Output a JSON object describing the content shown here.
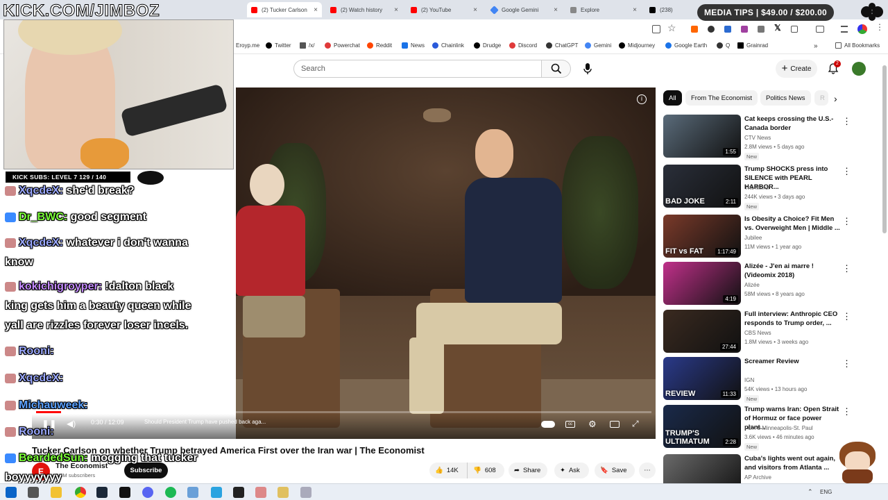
{
  "browser": {
    "tabs": [
      {
        "label": "(2) Tucker Carlson",
        "color": "#ff0000",
        "active": true
      },
      {
        "label": "(2) Watch history",
        "color": "#ff0000",
        "active": false
      },
      {
        "label": "(2) YouTube",
        "color": "#ff0000",
        "active": false
      },
      {
        "label": "Google Gemini",
        "color": "#4285f4",
        "active": false
      },
      {
        "label": "Explore",
        "color": "#888888",
        "active": false
      },
      {
        "label": "(238)",
        "color": "#000000",
        "active": false
      }
    ],
    "bookmarks": [
      {
        "label": "Eroyp.me",
        "color": "#999999"
      },
      {
        "label": "Twitter",
        "color": "#000000"
      },
      {
        "label": "/x/",
        "color": "#555555"
      },
      {
        "label": "Powerchat",
        "color": "#e03a3a"
      },
      {
        "label": "Reddit",
        "color": "#ff4500"
      },
      {
        "label": "News",
        "color": "#1a73e8"
      },
      {
        "label": "Chainlink",
        "color": "#2a5ada"
      },
      {
        "label": "Drudge",
        "color": "#000000"
      },
      {
        "label": "Discord",
        "color": "#5865f2"
      },
      {
        "label": "ChatGPT",
        "color": "#333333"
      },
      {
        "label": "Gemini",
        "color": "#4285f4"
      },
      {
        "label": "Midjourney",
        "color": "#000000"
      },
      {
        "label": "Google Earth",
        "color": "#1a73e8"
      },
      {
        "label": "Q",
        "color": "#333333"
      },
      {
        "label": "Grainrad",
        "color": "#000000"
      }
    ],
    "all_bookmarks": "All Bookmarks"
  },
  "header": {
    "search_placeholder": "Search",
    "create_label": "Create",
    "notif_count": "2"
  },
  "player": {
    "time": "0:30 / 12:09",
    "chapter": "Should President Trump have pushed back aga...",
    "progress": 0.041
  },
  "video": {
    "title": "Tucker Carlson on whether Trump betrayed America First over the Iran war | The Economist",
    "channel": "The Economist",
    "subscribers": "2.4M subscribers",
    "subscribe_label": "Subscribe",
    "likes": "14K",
    "dislikes": "608",
    "share_label": "Share",
    "ask_label": "Ask",
    "save_label": "Save"
  },
  "chips": [
    "All",
    "From The Economist",
    "Politics News",
    "R"
  ],
  "recommendations": [
    {
      "title": "Cat keeps crossing the U.S.-Canada border",
      "channel": "CTV News",
      "meta": "2.8M views • 5 days ago",
      "badge": "New",
      "duration": "1:55",
      "thumb_label": "",
      "thumb_color": "#5a6b7a"
    },
    {
      "title": "Trump SHOCKS press into SILENCE with PEARL HARBOR...",
      "channel": "The Mirror",
      "meta": "244K views • 3 days ago",
      "badge": "New",
      "duration": "2:11",
      "thumb_label": "BAD JOKE",
      "thumb_color": "#2a2f3a"
    },
    {
      "title": "Is Obesity a Choice? Fit Men vs. Overweight Men | Middle ...",
      "channel": "Jubilee",
      "meta": "11M views • 1 year ago",
      "badge": "",
      "duration": "1:17:49",
      "thumb_label": "FIT vs FAT",
      "thumb_color": "#7a3a2a"
    },
    {
      "title": "Alizée - J'en ai marre ! (Videomix 2018)",
      "channel": "Alizée",
      "meta": "58M views • 8 years ago",
      "badge": "",
      "duration": "4:19",
      "thumb_label": "",
      "thumb_color": "#c0308a"
    },
    {
      "title": "Full interview: Anthropic CEO responds to Trump order, ...",
      "channel": "CBS News",
      "meta": "1.8M views • 3 weeks ago",
      "badge": "",
      "duration": "27:44",
      "thumb_label": "",
      "thumb_color": "#3a2a20"
    },
    {
      "title": "Screamer Review",
      "channel": "IGN",
      "meta": "54K views • 13 hours ago",
      "badge": "New",
      "duration": "11:33",
      "thumb_label": "REVIEW",
      "thumb_color": "#2a3a8a"
    },
    {
      "title": "Trump warns Iran: Open Strait of Hormuz or face power plant...",
      "channel": "FOX 9 Minneapolis-St. Paul",
      "meta": "3.6K views • 46 minutes ago",
      "badge": "New",
      "duration": "2:28",
      "thumb_label": "TRUMP'S ULTIMATUM",
      "thumb_color": "#1a2a4a"
    },
    {
      "title": "Cuba's lights went out again, and visitors from Atlanta ...",
      "channel": "AP Archive",
      "meta": "",
      "badge": "",
      "duration": "",
      "thumb_label": "",
      "thumb_color": "#6a6a6a"
    }
  ],
  "overlay": {
    "kick": "KICK.COM/JIMBOZ",
    "media_tips": "MEDIA TIPS | $49.00 / $200.00",
    "subs_bar": "KICK SUBS: LEVEL 7 129 / 140",
    "chat": [
      {
        "user": "XqcdeX:",
        "msg": " she'd break?",
        "color": "#9aa8ff"
      },
      {
        "user": "Dr_BWC:",
        "msg": " good segment",
        "color": "#7cff3a"
      },
      {
        "user": "XqcdeX:",
        "msg": " whatever i don't wanna",
        "color": "#9aa8ff"
      },
      {
        "user": "",
        "msg": "know",
        "color": "#ffffff"
      },
      {
        "user": "kokichigroyper:",
        "msg": " !dalton black",
        "color": "#c58cff"
      },
      {
        "user": "",
        "msg": "king gets him a beauty queen while",
        "color": "#ffffff"
      },
      {
        "user": "",
        "msg": "yall are rizzles forever loser incels.",
        "color": "#ffffff"
      },
      {
        "user": "Rooni:",
        "msg": "",
        "color": "#9aa8ff"
      },
      {
        "user": "XqcdeX:",
        "msg": "",
        "color": "#9aa8ff"
      },
      {
        "user": "Michauweek:",
        "msg": "",
        "color": "#5aa0ff"
      },
      {
        "user": "Rooni:",
        "msg": "",
        "color": "#9aa8ff"
      },
      {
        "user": "BeardedSun:",
        "msg": " mogging that tucker",
        "color": "#7cff3a"
      },
      {
        "user": "",
        "msg": "boyyyyyyy",
        "color": "#ffffff"
      }
    ]
  },
  "taskbar": {
    "lang": "ENG"
  }
}
